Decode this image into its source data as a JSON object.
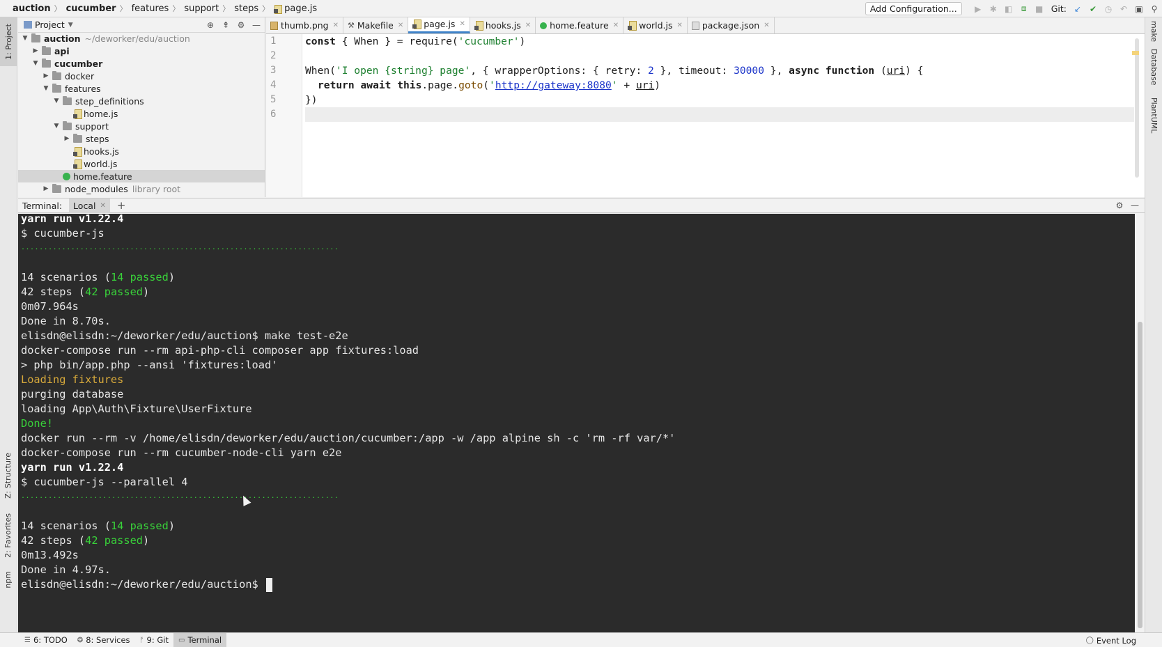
{
  "breadcrumb": [
    {
      "label": "auction",
      "bold": true
    },
    {
      "label": "cucumber",
      "bold": true
    },
    {
      "label": "features",
      "bold": false
    },
    {
      "label": "support",
      "bold": false
    },
    {
      "label": "steps",
      "bold": false
    },
    {
      "label": "page.js",
      "bold": false
    }
  ],
  "toolbar": {
    "add_config_label": "Add Configuration...",
    "git_label": "Git:"
  },
  "left_stripe": {
    "project_tab": "1: Project",
    "structure_tab": "Z: Structure",
    "favorites_tab": "2: Favorites",
    "npm_tab": "npm"
  },
  "right_stripe": {
    "make_tab": "make",
    "database_tab": "Database",
    "plantuml_tab": "PlantUML"
  },
  "project": {
    "title": "Project",
    "tree": [
      {
        "label": "auction",
        "hint": "~/deworker/edu/auction",
        "type": "folder",
        "expanded": true,
        "bold": true,
        "depth": 0
      },
      {
        "label": "api",
        "type": "folder",
        "expanded": false,
        "bold": true,
        "depth": 1
      },
      {
        "label": "cucumber",
        "type": "folder",
        "expanded": true,
        "bold": true,
        "depth": 1
      },
      {
        "label": "docker",
        "type": "folder",
        "expanded": false,
        "bold": false,
        "depth": 2
      },
      {
        "label": "features",
        "type": "folder",
        "expanded": true,
        "bold": false,
        "depth": 2
      },
      {
        "label": "step_definitions",
        "type": "folder",
        "expanded": true,
        "bold": false,
        "depth": 3
      },
      {
        "label": "home.js",
        "type": "js",
        "depth": 4
      },
      {
        "label": "support",
        "type": "folder",
        "expanded": true,
        "bold": false,
        "depth": 3
      },
      {
        "label": "steps",
        "type": "folder",
        "expanded": false,
        "bold": false,
        "depth": 4
      },
      {
        "label": "hooks.js",
        "type": "js",
        "depth": 4
      },
      {
        "label": "world.js",
        "type": "js",
        "depth": 4
      },
      {
        "label": "home.feature",
        "type": "feature",
        "depth": 3,
        "selected": true
      },
      {
        "label": "node_modules",
        "hint": "library root",
        "type": "folder",
        "expanded": false,
        "bold": false,
        "depth": 2
      }
    ]
  },
  "editor": {
    "tabs": [
      {
        "label": "thumb.png",
        "icon": "png",
        "active": false
      },
      {
        "label": "Makefile",
        "icon": "make",
        "active": false
      },
      {
        "label": "page.js",
        "icon": "js",
        "active": true
      },
      {
        "label": "hooks.js",
        "icon": "js",
        "active": false
      },
      {
        "label": "home.feature",
        "icon": "cuke",
        "active": false
      },
      {
        "label": "world.js",
        "icon": "js",
        "active": false
      },
      {
        "label": "package.json",
        "icon": "json",
        "active": false
      }
    ],
    "line_numbers": [
      "1",
      "2",
      "3",
      "4",
      "5",
      "6"
    ],
    "code": {
      "l1_kw": "const",
      "l1_rest": " { When } = require(",
      "l1_str": "'cucumber'",
      "l1_end": ")",
      "l3_a": "When(",
      "l3_str": "'I open {string} page'",
      "l3_b": ", { wrapperOptions: { retry: ",
      "l3_num1": "2",
      "l3_c": " }, timeout: ",
      "l3_num2": "30000",
      "l3_d": " }, ",
      "l3_kw": "async function",
      "l3_e": " (",
      "l3_param": "uri",
      "l3_f": ") {",
      "l4_kw": "return await this",
      "l4_a": ".page.",
      "l4_meth": "goto",
      "l4_b": "(",
      "l4_q1": "'",
      "l4_url": "http://gateway:8080",
      "l4_q2": "'",
      "l4_c": " + ",
      "l4_param": "uri",
      "l4_d": ")",
      "l5": "})"
    }
  },
  "terminal": {
    "label": "Terminal:",
    "tab": "Local",
    "lines": {
      "l1": "yarn run v1.22.4",
      "l2": "$ cucumber-js",
      "l3": "......................................................................",
      "l5_a": "14 scenarios (",
      "l5_g": "14 passed",
      "l5_b": ")",
      "l6_a": "42 steps (",
      "l6_g": "42 passed",
      "l6_b": ")",
      "l7": "0m07.964s",
      "l8": "Done in 8.70s.",
      "l9": "elisdn@elisdn:~/deworker/edu/auction$ make test-e2e",
      "l10": "docker-compose run --rm api-php-cli composer app fixtures:load",
      "l11": "> php bin/app.php --ansi 'fixtures:load'",
      "l12": "Loading fixtures",
      "l13": "purging database",
      "l14": "loading App\\Auth\\Fixture\\UserFixture",
      "l15": "Done!",
      "l16": "docker run --rm -v /home/elisdn/deworker/edu/auction/cucumber:/app -w /app alpine sh -c 'rm -rf var/*'",
      "l17": "docker-compose run --rm cucumber-node-cli yarn e2e",
      "l18": "yarn run v1.22.4",
      "l19": "$ cucumber-js --parallel 4",
      "l20": "......................................................................",
      "l22_a": "14 scenarios (",
      "l22_g": "14 passed",
      "l22_b": ")",
      "l23_a": "42 steps (",
      "l23_g": "42 passed",
      "l23_b": ")",
      "l24": "0m13.492s",
      "l25": "Done in 4.97s.",
      "l26": "elisdn@elisdn:~/deworker/edu/auction$ "
    }
  },
  "statusbar": {
    "todo": "6: TODO",
    "services": "8: Services",
    "git": "9: Git",
    "terminal": "Terminal",
    "event_log": "Event Log"
  }
}
